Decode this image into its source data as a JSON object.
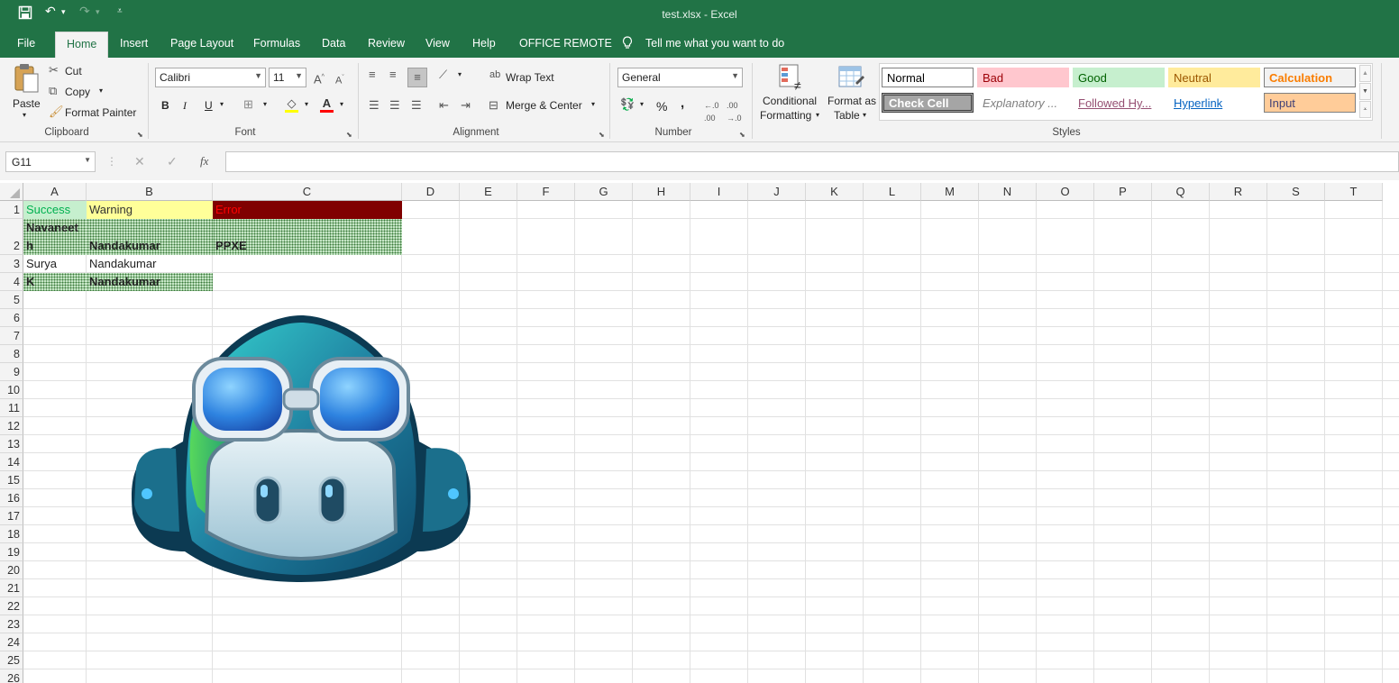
{
  "window": {
    "title": "test.xlsx  -  Excel"
  },
  "tabs": [
    {
      "label": "File"
    },
    {
      "label": "Home"
    },
    {
      "label": "Insert"
    },
    {
      "label": "Page Layout"
    },
    {
      "label": "Formulas"
    },
    {
      "label": "Data"
    },
    {
      "label": "Review"
    },
    {
      "label": "View"
    },
    {
      "label": "Help"
    },
    {
      "label": "OFFICE REMOTE"
    }
  ],
  "tellme": "Tell me what you want to do",
  "clipboard": {
    "paste": "Paste",
    "cut": "Cut",
    "copy": "Copy",
    "format_painter": "Format Painter",
    "label": "Clipboard"
  },
  "font": {
    "name": "Calibri",
    "size": "11",
    "label": "Font",
    "bold": "B",
    "italic": "I",
    "underline": "U"
  },
  "alignment": {
    "wrap": "Wrap Text",
    "merge": "Merge & Center",
    "label": "Alignment"
  },
  "number": {
    "format": "General",
    "label": "Number",
    "percent": "%",
    "comma": ","
  },
  "styles": {
    "conditional": [
      "Conditional",
      "Formatting"
    ],
    "format_table": [
      "Format as",
      "Table"
    ],
    "label": "Styles",
    "cells": [
      {
        "label": "Normal",
        "fg": "#000000",
        "bg": "#ffffff"
      },
      {
        "label": "Bad",
        "fg": "#9c0006",
        "bg": "#ffc7ce"
      },
      {
        "label": "Good",
        "fg": "#006100",
        "bg": "#c6efce"
      },
      {
        "label": "Neutral",
        "fg": "#9c5700",
        "bg": "#ffeb9c"
      },
      {
        "label": "Calculation",
        "fg": "#fa7d00",
        "bg": "#f2f2f2"
      },
      {
        "label": "Check Cell",
        "fg": "#ffffff",
        "bg": "#a5a5a5"
      },
      {
        "label": "Explanatory ...",
        "fg": "#7f7f7f",
        "bg": "transparent"
      },
      {
        "label": "Followed Hy...",
        "fg": "#954f72",
        "bg": "transparent"
      },
      {
        "label": "Hyperlink",
        "fg": "#0563c1",
        "bg": "transparent"
      },
      {
        "label": "Input",
        "fg": "#3f3f76",
        "bg": "#ffcc99"
      }
    ]
  },
  "formula_bar": {
    "name_box": "G11",
    "fx": "fx",
    "value": ""
  },
  "columns": [
    "A",
    "B",
    "C",
    "D",
    "E",
    "F",
    "G",
    "H",
    "I",
    "J",
    "K",
    "L",
    "M",
    "N",
    "O",
    "P",
    "Q",
    "R",
    "S",
    "T"
  ],
  "rows": [
    "1",
    "2",
    "3",
    "4",
    "5",
    "6",
    "7",
    "8",
    "9",
    "10",
    "11",
    "12",
    "13",
    "14",
    "15",
    "16",
    "17",
    "18",
    "19",
    "20",
    "21",
    "22",
    "23",
    "24",
    "25",
    "26"
  ],
  "cells": {
    "A1": "Success",
    "B1": "Warning",
    "C1": "Error",
    "A2": "Navaneet\nh",
    "B2": "Nandakumar",
    "C2": "PPXE",
    "A3": "Surya",
    "B3": "Nandakumar",
    "A4": "K",
    "B4": "Nandakumar"
  },
  "colors": {
    "brand": "#217346",
    "success_bg": "#c6efce",
    "success_fg": "#006100",
    "warning_bg": "#ffff99",
    "error_bg": "#800000",
    "error_fg": "#ff0000"
  }
}
